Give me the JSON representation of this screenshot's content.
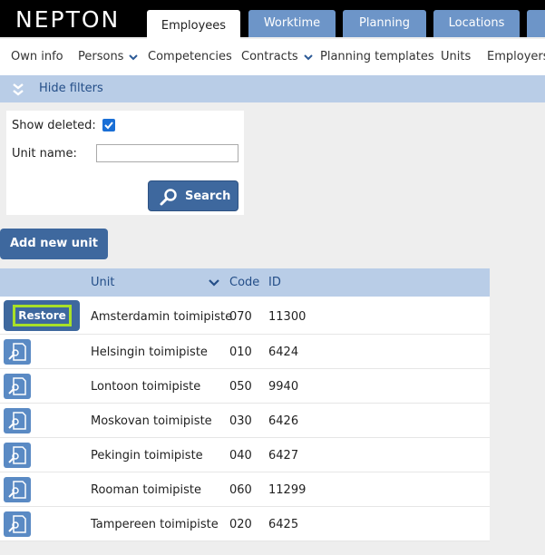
{
  "app": {
    "logo": "NEPTON"
  },
  "tabs": [
    {
      "label": "Employees",
      "active": true
    },
    {
      "label": "Worktime"
    },
    {
      "label": "Planning"
    },
    {
      "label": "Locations"
    }
  ],
  "subnav": [
    {
      "label": "Own info"
    },
    {
      "label": "Persons",
      "dropdown": true
    },
    {
      "label": "Competencies"
    },
    {
      "label": "Contracts",
      "dropdown": true
    },
    {
      "label": "Planning templates"
    },
    {
      "label": "Units"
    },
    {
      "label": "Employers"
    }
  ],
  "filters": {
    "toggle_label": "Hide filters",
    "show_deleted_label": "Show deleted:",
    "show_deleted_checked": true,
    "unit_name_label": "Unit name:",
    "unit_name_value": "",
    "search_label": "Search"
  },
  "add_unit_label": "Add new unit",
  "table": {
    "headers": {
      "unit": "Unit",
      "code": "Code",
      "id": "ID"
    },
    "restore_label": "Restore",
    "rows": [
      {
        "unit": "Amsterdamin toimipiste",
        "code": "070",
        "id": "11300",
        "deleted": true
      },
      {
        "unit": "Helsingin toimipiste",
        "code": "010",
        "id": "6424"
      },
      {
        "unit": "Lontoon toimipiste",
        "code": "050",
        "id": "9940"
      },
      {
        "unit": "Moskovan toimipiste",
        "code": "030",
        "id": "6426"
      },
      {
        "unit": "Pekingin toimipiste",
        "code": "040",
        "id": "6427"
      },
      {
        "unit": "Rooman toimipiste",
        "code": "060",
        "id": "11299"
      },
      {
        "unit": "Tampereen toimipiste",
        "code": "020",
        "id": "6425"
      }
    ]
  },
  "colors": {
    "tab_blue": "#6d95c8",
    "button_blue": "#3e689e",
    "filter_bar": "#b9cde7",
    "highlight": "#a8e028"
  }
}
